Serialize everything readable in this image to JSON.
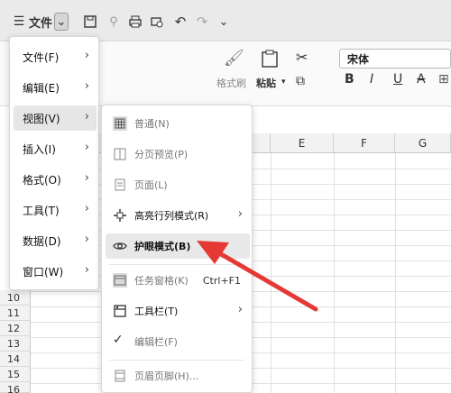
{
  "toolbar": {
    "menu_label": "文件",
    "arrow_label": "⌄"
  },
  "ribbon": {
    "format_painter": "格式刷",
    "paste": "粘贴",
    "font": "宋体",
    "bold": "B",
    "italic": "I",
    "underline": "U",
    "strike": "A"
  },
  "columns": [
    "E",
    "F",
    "G"
  ],
  "rows": [
    "10",
    "11",
    "12",
    "13",
    "14",
    "15",
    "16"
  ],
  "menu": {
    "items": [
      {
        "label": "文件(F)"
      },
      {
        "label": "编辑(E)"
      },
      {
        "label": "视图(V)"
      },
      {
        "label": "插入(I)"
      },
      {
        "label": "格式(O)"
      },
      {
        "label": "工具(T)"
      },
      {
        "label": "数据(D)"
      },
      {
        "label": "窗口(W)"
      }
    ]
  },
  "view_menu": {
    "items": [
      {
        "label": "普通(N)"
      },
      {
        "label": "分页预览(P)"
      },
      {
        "label": "页面(L)"
      },
      {
        "label": "高亮行列模式(R)"
      },
      {
        "label": "护眼模式(B)"
      },
      {
        "label": "任务窗格(K)",
        "shortcut": "Ctrl+F1"
      },
      {
        "label": "工具栏(T)"
      },
      {
        "label": "编辑栏(F)"
      },
      {
        "label": "页眉页脚(H)..."
      }
    ]
  },
  "colors": {
    "arrow": "#e53935",
    "accent": "#e6e6e6"
  }
}
